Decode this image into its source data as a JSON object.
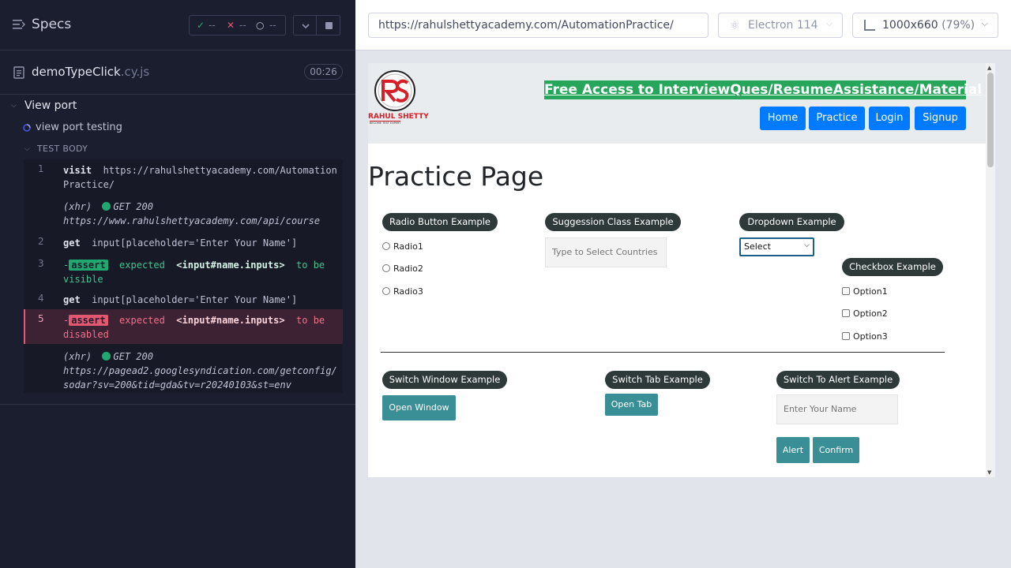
{
  "reporter": {
    "title": "Specs",
    "stats": {
      "passed": "--",
      "failed": "--",
      "pending": "--"
    },
    "spec_file": "demoTypeClick",
    "spec_ext": ".cy.js",
    "duration": "00:26",
    "suite": "View port",
    "test": "view port testing",
    "test_body_label": "TEST BODY",
    "commands": [
      {
        "num": "1",
        "name": "visit",
        "arg": "https://rahulshettyacademy.com/AutomationPractice/"
      },
      {
        "xhr": "(xhr)",
        "status": "GET 200",
        "url": "https://www.rahulshettyacademy.com/api/course"
      },
      {
        "num": "2",
        "name": "get",
        "arg": "input[placeholder='Enter Your Name']"
      },
      {
        "num": "3",
        "prefix": "-",
        "tag": "assert",
        "word": "expected",
        "selector": "<input#name.inputs>",
        "rest": "to be visible"
      },
      {
        "num": "4",
        "name": "get",
        "arg": "input[placeholder='Enter Your Name']"
      },
      {
        "num": "5",
        "prefix": "-",
        "tag": "assert",
        "word": "expected",
        "selector": "<input#name.inputs>",
        "rest": "to be disabled"
      },
      {
        "xhr": "(xhr)",
        "status": "GET 200",
        "url": "https://pagead2.googlesyndication.com/getconfig/sodar?sv=200&tid=gda&tv=r20240103&st=env"
      }
    ]
  },
  "browser": {
    "url": "https://rahulshettyacademy.com/AutomationPractice/",
    "name": "Electron 114",
    "viewport": "1000x660",
    "zoom": "(79%)"
  },
  "site": {
    "logo_text": "RAHUL SHETTY",
    "logo_sub": "BECOME TEST EXPERT",
    "banner": "Free Access to InterviewQues/ResumeAssistance/Material",
    "nav": [
      "Home",
      "Practice",
      "Login",
      "Signup"
    ],
    "heading": "Practice Page",
    "radio_title": "Radio Button Example",
    "radios": [
      "Radio1",
      "Radio2",
      "Radio3"
    ],
    "suggest_title": "Suggession Class Example",
    "suggest_placeholder": "Type to Select Countries",
    "dropdown_title": "Dropdown Example",
    "dropdown_value": "Select",
    "checkbox_title": "Checkbox Example",
    "checkboxes": [
      "Option1",
      "Option2",
      "Option3"
    ],
    "window_title": "Switch Window Example",
    "open_window": "Open Window",
    "tab_title": "Switch Tab Example",
    "open_tab": "Open Tab",
    "alert_title": "Switch To Alert Example",
    "name_placeholder": "Enter Your Name",
    "alert_btn": "Alert",
    "confirm_btn": "Confirm"
  },
  "colors": {
    "reporter_bg": "#1b1e2e",
    "pass": "#1fa971",
    "fail": "#e45770",
    "banner": "#26a65b",
    "nav_button": "#007bff",
    "teal_button": "#3a8e95"
  }
}
